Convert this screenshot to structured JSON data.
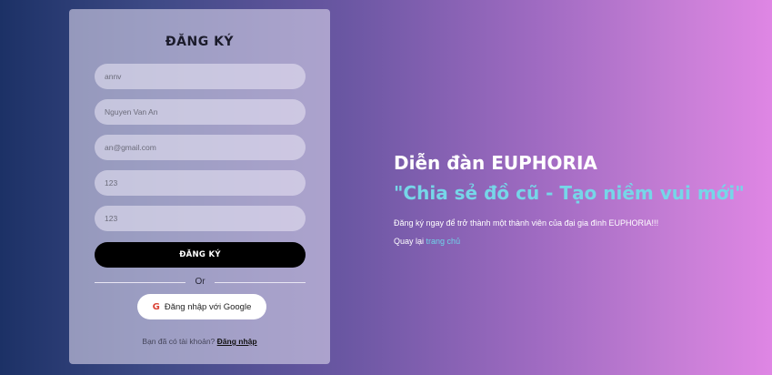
{
  "form": {
    "title": "ĐĂNG KÝ",
    "fields": [
      {
        "name": "username",
        "value": "annv"
      },
      {
        "name": "fullname",
        "value": "Nguyen Van An"
      },
      {
        "name": "email",
        "value": "an@gmail.com"
      },
      {
        "name": "password",
        "value": "123"
      },
      {
        "name": "confirm_password",
        "value": "123"
      }
    ],
    "submit_label": "ĐĂNG KÝ",
    "or_label": "Or",
    "google_icon": "google-g-icon",
    "google_glyph": "G",
    "google_label": "Đăng nhập với Google",
    "have_account_text": "Bạn đã có tài khoản?",
    "login_link": "Đăng nhập"
  },
  "hero": {
    "title": "Diễn đàn EUPHORIA",
    "slogan": "\"Chia sẻ đồ cũ - Tạo niềm vui mới\"",
    "description": "Đăng ký ngay để trở thành một thành viên của đại gia đình EUPHORIA!!!",
    "back_text": "Quay lại",
    "home_link": "trang chủ"
  },
  "colors": {
    "gradient_start": "#1c3166",
    "gradient_end": "#df86e4",
    "slogan": "#76d6e8",
    "link": "#6fd4ea",
    "submit_bg": "#000000"
  }
}
